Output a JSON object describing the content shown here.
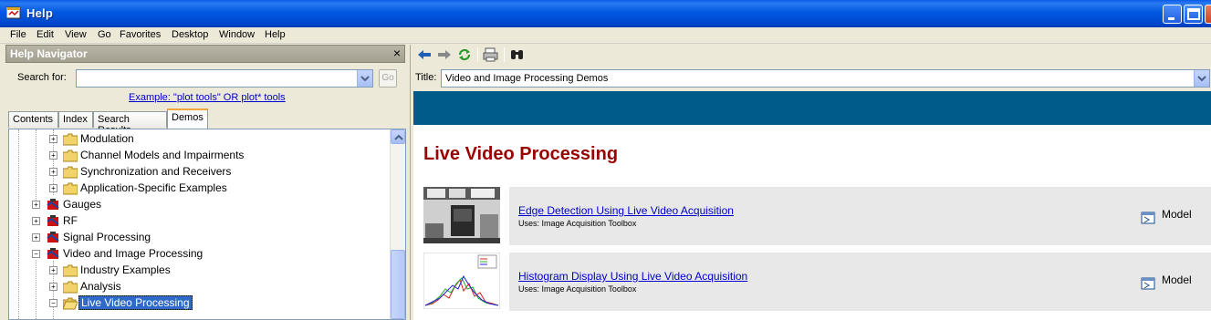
{
  "window": {
    "title": "Help"
  },
  "menu": [
    "File",
    "Edit",
    "View",
    "Go",
    "Favorites",
    "Desktop",
    "Window",
    "Help"
  ],
  "navigator": {
    "header": "Help Navigator",
    "close_glyph": "×",
    "search_label": "Search for:",
    "search_value": "",
    "go_label": "Go",
    "example_link": "Example: \"plot tools\" OR plot* tools",
    "tabs": [
      "Contents",
      "Index",
      "Search Results",
      "Demos"
    ],
    "active_tab": "Demos",
    "tree": [
      {
        "label": "Modulation",
        "icon": "folder-icon"
      },
      {
        "label": "Channel Models and Impairments",
        "icon": "folder-icon"
      },
      {
        "label": "Synchronization and Receivers",
        "icon": "folder-icon"
      },
      {
        "label": "Application-Specific Examples",
        "icon": "folder-icon"
      },
      {
        "label": "Gauges",
        "icon": "blockset-icon"
      },
      {
        "label": "RF",
        "icon": "blockset-icon"
      },
      {
        "label": "Signal Processing",
        "icon": "blockset-icon"
      },
      {
        "label": "Video and Image Processing",
        "icon": "blockset-icon"
      },
      {
        "label": "Industry Examples",
        "icon": "folder-icon"
      },
      {
        "label": "Analysis",
        "icon": "folder-icon"
      },
      {
        "label": "Live Video Processing",
        "icon": "folder-open-icon"
      }
    ]
  },
  "browser": {
    "title_label": "Title:",
    "title_value": "Video and Image Processing Demos",
    "heading": "Live Video Processing",
    "demos": [
      {
        "title": "Edge Detection Using Live Video Acquisition",
        "uses": "Uses: Image Acquisition Toolbox",
        "action": "Model"
      },
      {
        "title": "Histogram Display Using Live Video Acquisition",
        "uses": "Uses: Image Acquisition Toolbox",
        "action": "Model"
      }
    ]
  },
  "colors": {
    "banner": "#005b8a",
    "heading": "#990000",
    "selection": "#316ac5"
  }
}
